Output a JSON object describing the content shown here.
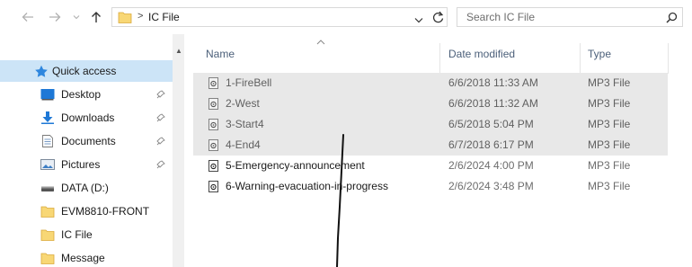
{
  "address": {
    "separator": ">",
    "path": "IC File"
  },
  "search": {
    "placeholder": "Search IC File"
  },
  "nav": {
    "items": [
      {
        "label": "Quick access",
        "icon": "star-icon"
      },
      {
        "label": "Desktop",
        "icon": "desktop-icon"
      },
      {
        "label": "Downloads",
        "icon": "downloads-icon"
      },
      {
        "label": "Documents",
        "icon": "documents-icon"
      },
      {
        "label": "Pictures",
        "icon": "pictures-icon"
      },
      {
        "label": "DATA (D:)",
        "icon": "drive-icon"
      },
      {
        "label": "EVM8810-FRONT",
        "icon": "folder-icon"
      },
      {
        "label": "IC File",
        "icon": "folder-icon"
      },
      {
        "label": "Message",
        "icon": "folder-icon"
      }
    ]
  },
  "columns": {
    "name": "Name",
    "date": "Date modified",
    "type": "Type"
  },
  "files": [
    {
      "name": "1-FireBell",
      "date": "6/6/2018 11:33 AM",
      "type": "MP3 File"
    },
    {
      "name": "2-West",
      "date": "6/6/2018 11:32 AM",
      "type": "MP3 File"
    },
    {
      "name": "3-Start4",
      "date": "6/5/2018 5:04 PM",
      "type": "MP3 File"
    },
    {
      "name": "4-End4",
      "date": "6/7/2018 6:17 PM",
      "type": "MP3 File"
    },
    {
      "name": "5-Emergency-announcement",
      "date": "2/6/2024 4:00 PM",
      "type": "MP3 File"
    },
    {
      "name": "6-Warning-evacuation-in-progress",
      "date": "2/6/2024 3:48 PM",
      "type": "MP3 File"
    }
  ],
  "colors": {
    "selected_nav": "#cce4f7",
    "highlighted_rows": "#e8e8e8",
    "folder_yellow": "#f8d775",
    "accent_blue": "#1e78d6"
  }
}
